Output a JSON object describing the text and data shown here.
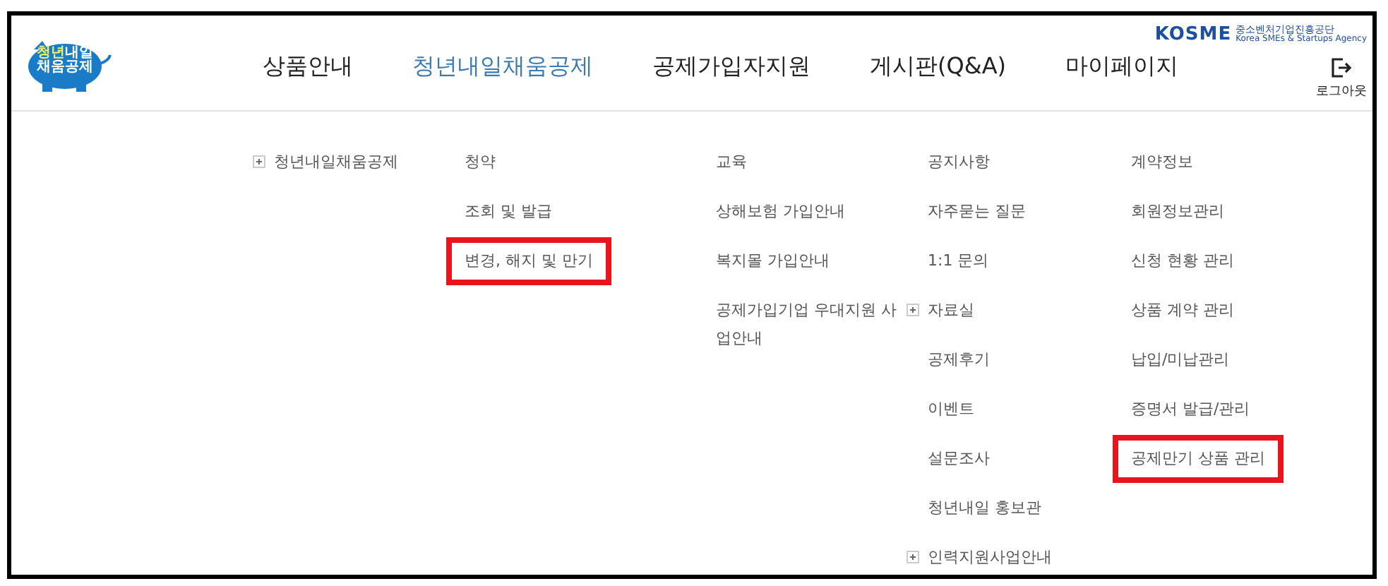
{
  "logo": {
    "line_1_highlight": "청년",
    "line_1_rest": "내일",
    "line_2": "채움공제"
  },
  "agency": {
    "name": "KOSME",
    "korean_name": "중소벤처기업진흥공단",
    "english_name": "Korea SMEs & Startups Agency"
  },
  "nav": [
    {
      "label": "상품안내",
      "selected": false
    },
    {
      "label": "청년내일채움공제",
      "selected": true
    },
    {
      "label": "공제가입자지원",
      "selected": false
    },
    {
      "label": "게시판(Q&A)",
      "selected": false
    },
    {
      "label": "마이페이지",
      "selected": false
    }
  ],
  "logout": {
    "label": "로그아웃"
  },
  "menu_columns": [
    [
      {
        "label": "청년내일채움공제",
        "expandable": true,
        "highlighted": false
      }
    ],
    [
      {
        "label": "청약",
        "expandable": false,
        "highlighted": false
      },
      {
        "label": "조회 및 발급",
        "expandable": false,
        "highlighted": false
      },
      {
        "label": "변경, 해지 및 만기",
        "expandable": false,
        "highlighted": true
      }
    ],
    [
      {
        "label": "교육",
        "expandable": false,
        "highlighted": false
      },
      {
        "label": "상해보험 가입안내",
        "expandable": false,
        "highlighted": false
      },
      {
        "label": "복지몰 가입안내",
        "expandable": false,
        "highlighted": false
      },
      {
        "label": "공제가입기업 우대지원 사업안내",
        "expandable": false,
        "highlighted": false
      }
    ],
    [
      {
        "label": "공지사항",
        "expandable": false,
        "highlighted": false
      },
      {
        "label": "자주묻는 질문",
        "expandable": false,
        "highlighted": false
      },
      {
        "label": "1:1 문의",
        "expandable": false,
        "highlighted": false
      },
      {
        "label": "자료실",
        "expandable": true,
        "highlighted": false
      },
      {
        "label": "공제후기",
        "expandable": false,
        "highlighted": false
      },
      {
        "label": "이벤트",
        "expandable": false,
        "highlighted": false
      },
      {
        "label": "설문조사",
        "expandable": false,
        "highlighted": false
      },
      {
        "label": "청년내일 홍보관",
        "expandable": false,
        "highlighted": false
      },
      {
        "label": "인력지원사업안내",
        "expandable": true,
        "highlighted": false
      }
    ],
    [
      {
        "label": "계약정보",
        "expandable": false,
        "highlighted": false
      },
      {
        "label": "회원정보관리",
        "expandable": false,
        "highlighted": false
      },
      {
        "label": "신청 현황 관리",
        "expandable": false,
        "highlighted": false
      },
      {
        "label": "상품 계약 관리",
        "expandable": false,
        "highlighted": false
      },
      {
        "label": "납입/미납관리",
        "expandable": false,
        "highlighted": false
      },
      {
        "label": "증명서 발급/관리",
        "expandable": false,
        "highlighted": false
      },
      {
        "label": "공제만기 상품 관리",
        "expandable": false,
        "highlighted": true
      }
    ]
  ]
}
